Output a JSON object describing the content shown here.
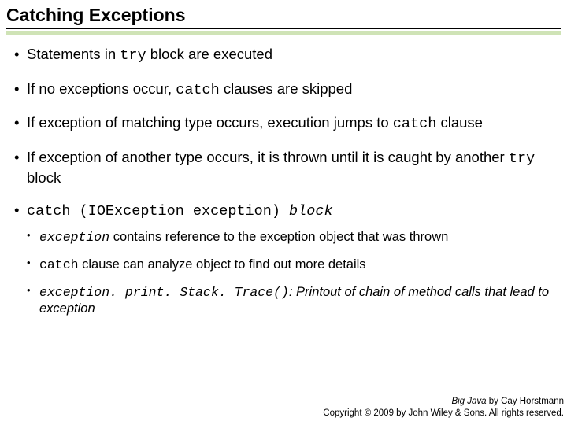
{
  "title": "Catching Exceptions",
  "bullets": {
    "b1a": "Statements in ",
    "b1b": "try",
    "b1c": " block are executed",
    "b2a": "If no exceptions occur, ",
    "b2b": "catch",
    "b2c": " clauses are skipped",
    "b3a": "If exception of matching type occurs, execution jumps to ",
    "b3b": "catch",
    "b3c": " clause",
    "b4a": "If exception of another type occurs, it is thrown until it is caught by another ",
    "b4b": "try",
    "b4c": " block",
    "b5a": "catch (IOException exception)",
    "b5b": " block",
    "sub": {
      "s1a": "exception",
      "s1b": " contains reference to the exception object that was thrown",
      "s2a": "catch",
      "s2b": " clause can analyze object to find out more details",
      "s3a": "exception. print. Stack. Trace()",
      "s3b": ": Printout of chain of method calls that lead to exception"
    }
  },
  "footer": {
    "book": "Big Java",
    "by": " by  Cay Horstmann",
    "copy": "Copyright © 2009 by John Wiley & Sons.  All rights reserved."
  }
}
